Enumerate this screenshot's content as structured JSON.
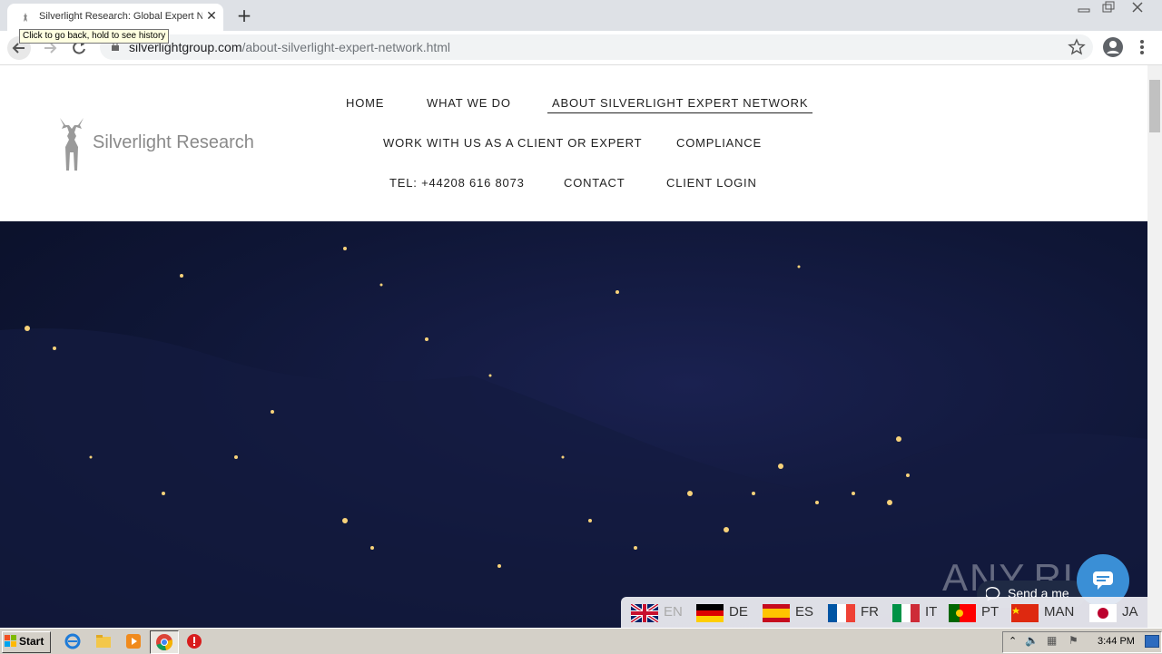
{
  "browser": {
    "tab_title": "Silverlight Research: Global Expert Network",
    "url_domain": "silverlightgroup.com",
    "url_path": "/about-silverlight-expert-network.html",
    "tooltip": "Click to go back, hold to see history"
  },
  "site": {
    "logo_text": "Silverlight Research",
    "nav": [
      {
        "label": "HOME"
      },
      {
        "label": "WHAT WE DO"
      },
      {
        "label": "ABOUT SILVERLIGHT EXPERT NETWORK"
      },
      {
        "label": "WORK WITH US AS A CLIENT OR EXPERT"
      },
      {
        "label": "COMPLIANCE"
      },
      {
        "label": "TEL: +44208 616 8073"
      },
      {
        "label": "CONTACT"
      },
      {
        "label": "CLIENT LOGIN"
      }
    ],
    "languages": [
      {
        "code": "EN"
      },
      {
        "code": "DE"
      },
      {
        "code": "ES"
      },
      {
        "code": "FR"
      },
      {
        "code": "IT"
      },
      {
        "code": "PT"
      },
      {
        "code": "MAN"
      },
      {
        "code": "JA"
      }
    ],
    "chat_label": "Send a me",
    "watermark": "ANY.RUN"
  },
  "taskbar": {
    "start_label": "Start",
    "clock": "3:44 PM"
  }
}
